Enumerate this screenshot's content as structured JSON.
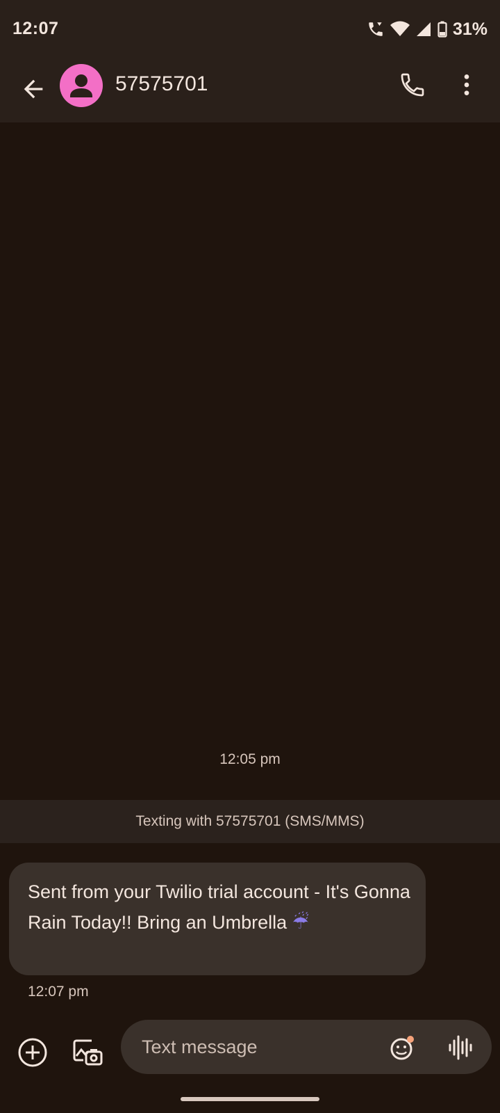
{
  "status_bar": {
    "time": "12:07",
    "battery_percent": "31%"
  },
  "app_bar": {
    "contact_name": "57575701"
  },
  "thread": {
    "timestamp": "12:05 pm",
    "texting_with": "Texting with 57575701 (SMS/MMS)",
    "messages": [
      {
        "text": "Sent from your Twilio trial account - It's Gonna Rain Today!! Bring an Umbrella",
        "emoji": "☔",
        "time": "12:07 pm"
      }
    ]
  },
  "compose": {
    "placeholder": "Text message"
  },
  "colors": {
    "avatar": "#f36fc6",
    "notification_dot": "#f5a27a"
  }
}
